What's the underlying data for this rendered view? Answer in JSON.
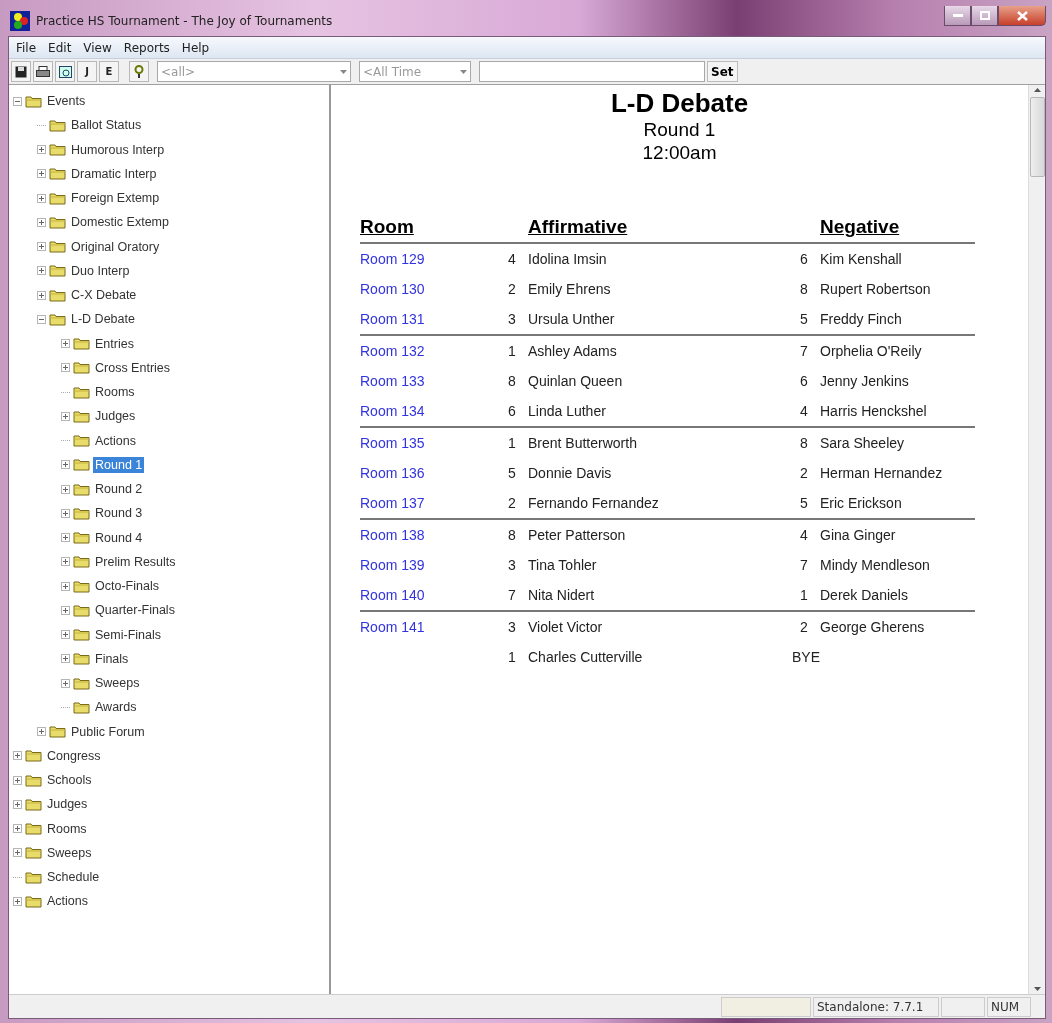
{
  "window": {
    "title": "Practice HS Tournament - The Joy of Tournaments"
  },
  "menu": [
    "File",
    "Edit",
    "View",
    "Reports",
    "Help"
  ],
  "toolbar": {
    "buttons": [
      {
        "kind": "save"
      },
      {
        "kind": "print"
      },
      {
        "kind": "preview"
      },
      {
        "kind": "text",
        "label": "J"
      },
      {
        "kind": "text",
        "label": "E"
      },
      {
        "kind": "help"
      }
    ],
    "event_select": {
      "value": "<all>"
    },
    "time_select": {
      "value": "<All Time"
    },
    "set_button": "Set"
  },
  "tree": [
    {
      "label": "Events",
      "expanded": true,
      "selected": false,
      "children": [
        {
          "label": "Ballot Status",
          "selected": false
        },
        {
          "label": "Humorous Interp",
          "expanded": false,
          "selected": false
        },
        {
          "label": "Dramatic Interp",
          "expanded": false,
          "selected": false
        },
        {
          "label": "Foreign Extemp",
          "expanded": false,
          "selected": false
        },
        {
          "label": "Domestic Extemp",
          "expanded": false,
          "selected": false
        },
        {
          "label": "Original Oratory",
          "expanded": false,
          "selected": false
        },
        {
          "label": "Duo Interp",
          "expanded": false,
          "selected": false
        },
        {
          "label": "C-X Debate",
          "expanded": false,
          "selected": false
        },
        {
          "label": "L-D Debate",
          "expanded": true,
          "selected": false,
          "children": [
            {
              "label": "Entries",
              "expanded": false,
              "selected": false
            },
            {
              "label": "Cross Entries",
              "expanded": false,
              "selected": false
            },
            {
              "label": "Rooms",
              "selected": false
            },
            {
              "label": "Judges",
              "expanded": false,
              "selected": false
            },
            {
              "label": "Actions",
              "selected": false
            },
            {
              "label": "Round 1",
              "expanded": false,
              "selected": true
            },
            {
              "label": "Round 2",
              "expanded": false,
              "selected": false
            },
            {
              "label": "Round 3",
              "expanded": false,
              "selected": false
            },
            {
              "label": "Round 4",
              "expanded": false,
              "selected": false
            },
            {
              "label": "Prelim Results",
              "expanded": false,
              "selected": false
            },
            {
              "label": "Octo-Finals",
              "expanded": false,
              "selected": false
            },
            {
              "label": "Quarter-Finals",
              "expanded": false,
              "selected": false
            },
            {
              "label": "Semi-Finals",
              "expanded": false,
              "selected": false
            },
            {
              "label": "Finals",
              "expanded": false,
              "selected": false
            },
            {
              "label": "Sweeps",
              "expanded": false,
              "selected": false
            },
            {
              "label": "Awards",
              "selected": false
            }
          ]
        },
        {
          "label": "Public Forum",
          "expanded": false,
          "selected": false
        }
      ]
    },
    {
      "label": "Congress",
      "expanded": false,
      "selected": false
    },
    {
      "label": "Schools",
      "expanded": false,
      "selected": false
    },
    {
      "label": "Judges",
      "expanded": false,
      "selected": false
    },
    {
      "label": "Rooms",
      "expanded": false,
      "selected": false
    },
    {
      "label": "Sweeps",
      "expanded": false,
      "selected": false
    },
    {
      "label": "Schedule",
      "selected": false
    },
    {
      "label": "Actions",
      "expanded": false,
      "selected": false
    }
  ],
  "report": {
    "title": "L-D Debate",
    "subtitle": "Round 1",
    "time": "12:00am",
    "columns": [
      "Room",
      "Affirmative",
      "Negative"
    ],
    "groups": [
      {
        "rows": [
          {
            "room": "Room 129",
            "aff_seed": "4",
            "aff": "Idolina Imsin",
            "neg_seed": "6",
            "neg": "Kim Kenshall"
          },
          {
            "room": "Room 130",
            "aff_seed": "2",
            "aff": "Emily Ehrens",
            "neg_seed": "8",
            "neg": "Rupert Robertson"
          },
          {
            "room": "Room 131",
            "aff_seed": "3",
            "aff": "Ursula Unther",
            "neg_seed": "5",
            "neg": "Freddy Finch"
          }
        ]
      },
      {
        "rows": [
          {
            "room": "Room 132",
            "aff_seed": "1",
            "aff": "Ashley Adams",
            "neg_seed": "7",
            "neg": "Orphelia O'Reily"
          },
          {
            "room": "Room 133",
            "aff_seed": "8",
            "aff": "Quinlan Queen",
            "neg_seed": "6",
            "neg": "Jenny Jenkins"
          },
          {
            "room": "Room 134",
            "aff_seed": "6",
            "aff": "Linda Luther",
            "neg_seed": "4",
            "neg": "Harris Henckshel"
          }
        ]
      },
      {
        "rows": [
          {
            "room": "Room 135",
            "aff_seed": "1",
            "aff": "Brent Butterworth",
            "neg_seed": "8",
            "neg": "Sara Sheeley"
          },
          {
            "room": "Room 136",
            "aff_seed": "5",
            "aff": "Donnie Davis",
            "neg_seed": "2",
            "neg": "Herman Hernandez"
          },
          {
            "room": "Room 137",
            "aff_seed": "2",
            "aff": "Fernando Fernandez",
            "neg_seed": "5",
            "neg": "Eric Erickson"
          }
        ]
      },
      {
        "rows": [
          {
            "room": "Room 138",
            "aff_seed": "8",
            "aff": "Peter Patterson",
            "neg_seed": "4",
            "neg": "Gina Ginger"
          },
          {
            "room": "Room 139",
            "aff_seed": "3",
            "aff": "Tina Tohler",
            "neg_seed": "7",
            "neg": "Mindy Mendleson"
          },
          {
            "room": "Room 140",
            "aff_seed": "7",
            "aff": "Nita Nidert",
            "neg_seed": "1",
            "neg": "Derek Daniels"
          }
        ]
      },
      {
        "rows": [
          {
            "room": "Room 141",
            "aff_seed": "3",
            "aff": "Violet Victor",
            "neg_seed": "2",
            "neg": "George Gherens"
          }
        ]
      }
    ],
    "bye": {
      "seed": "1",
      "name": "Charles Cutterville",
      "label": "BYE"
    }
  },
  "status_bar": {
    "version": "Standalone: 7.7.1",
    "num": "NUM"
  }
}
